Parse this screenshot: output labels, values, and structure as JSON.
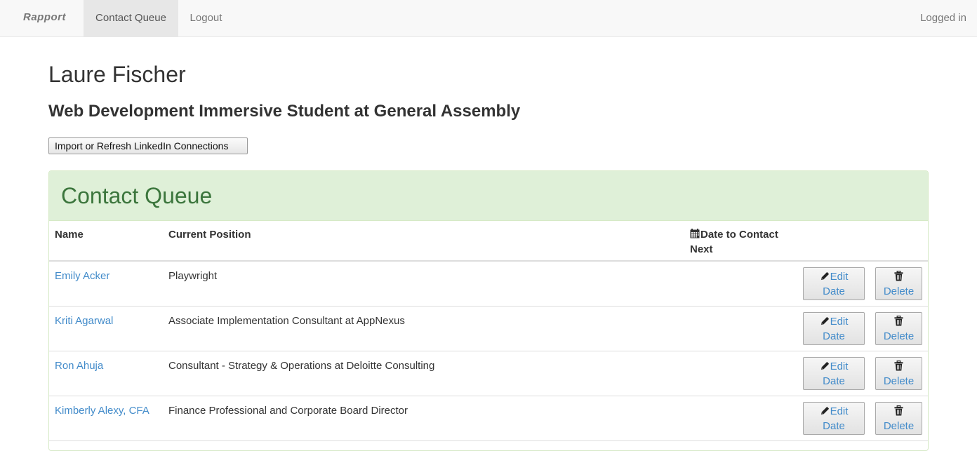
{
  "navbar": {
    "brand": "Rapport",
    "items": [
      {
        "label": "Contact Queue",
        "active": true
      },
      {
        "label": "Logout",
        "active": false
      }
    ],
    "status": "Logged in"
  },
  "profile": {
    "name": "Laure Fischer",
    "headline": "Web Development Immersive Student at General Assembly",
    "import_button": "Import or Refresh LinkedIn Connections"
  },
  "queue": {
    "title": "Contact Queue",
    "columns": {
      "name": "Name",
      "position": "Current Position",
      "date": "Date to Contact Next"
    },
    "edit_label_1": "Edit",
    "edit_label_2": "Date",
    "delete_label": "Delete",
    "rows": [
      {
        "name": "Emily Acker",
        "position": "Playwright",
        "date": ""
      },
      {
        "name": "Kriti Agarwal",
        "position": "Associate Implementation Consultant at AppNexus",
        "date": ""
      },
      {
        "name": "Ron Ahuja",
        "position": "Consultant - Strategy & Operations at Deloitte Consulting",
        "date": ""
      },
      {
        "name": "Kimberly Alexy, CFA",
        "position": "Finance Professional and Corporate Board Director",
        "date": ""
      }
    ]
  },
  "colors": {
    "navbar_bg": "#f8f8f8",
    "panel_heading_bg": "#dff0d8",
    "panel_title": "#3c763d",
    "link": "#428bca"
  },
  "icons": {
    "calendar": "calendar-icon",
    "edit": "pencil-icon",
    "delete": "trash-icon"
  }
}
